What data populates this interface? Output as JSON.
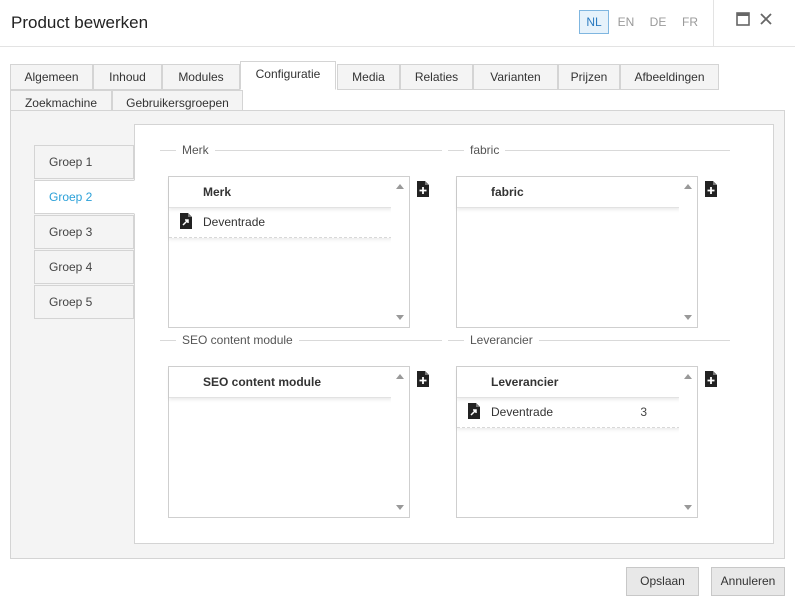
{
  "window": {
    "title": "Product bewerken"
  },
  "languages": [
    {
      "code": "NL",
      "active": true
    },
    {
      "code": "EN",
      "active": false
    },
    {
      "code": "DE",
      "active": false
    },
    {
      "code": "FR",
      "active": false
    }
  ],
  "tabs": {
    "row1": [
      "Algemeen",
      "Inhoud",
      "Modules",
      "Configuratie",
      "Media",
      "Relaties",
      "Varianten",
      "Prijzen",
      "Afbeeldingen"
    ],
    "row2": [
      "Zoekmachine",
      "Gebruikersgroepen"
    ],
    "active": "Configuratie"
  },
  "groups": {
    "items": [
      "Groep 1",
      "Groep 2",
      "Groep 3",
      "Groep 4",
      "Groep 5"
    ],
    "active": "Groep 2"
  },
  "sections": [
    {
      "label": "Merk",
      "header": "Merk",
      "rows": [
        {
          "name": "Deventrade",
          "count": ""
        }
      ]
    },
    {
      "label": "fabric",
      "header": "fabric",
      "rows": []
    },
    {
      "label": "SEO content module",
      "header": "SEO content module",
      "rows": []
    },
    {
      "label": "Leverancier",
      "header": "Leverancier",
      "rows": [
        {
          "name": "Deventrade",
          "count": "3"
        }
      ]
    }
  ],
  "footer": {
    "save_label": "Opslaan",
    "cancel_label": "Annuleren"
  },
  "colors": {
    "accent": "#2aa0d8",
    "lang_active": "#2a7ac0"
  },
  "icons": {
    "maximize": "maximize-icon",
    "close": "close-icon",
    "add": "add-document-icon",
    "item": "document-link-icon",
    "scroll_up": "scroll-up-arrow-icon",
    "scroll_down": "scroll-down-arrow-icon"
  }
}
